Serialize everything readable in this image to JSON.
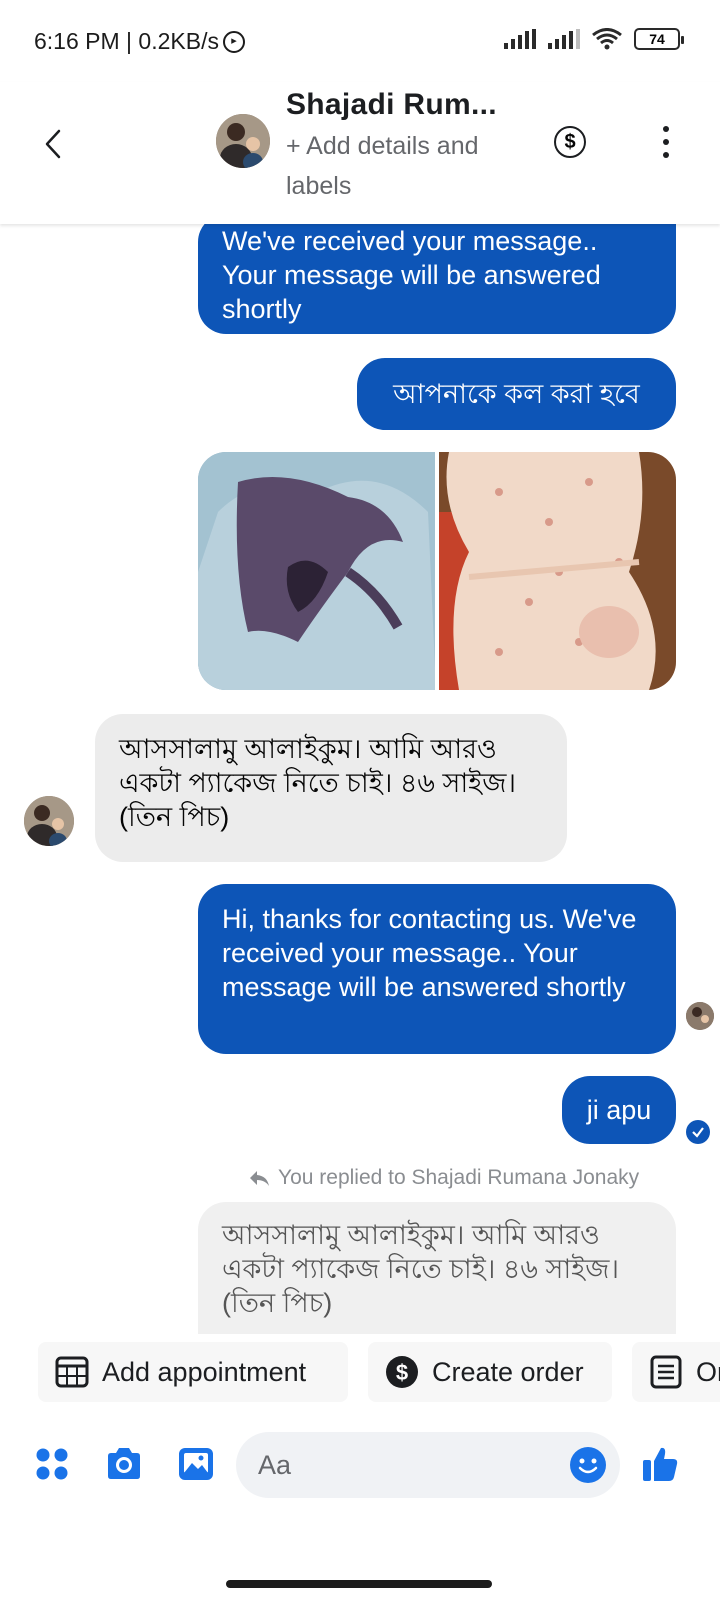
{
  "status_bar": {
    "time_speed": "6:16 PM | 0.2KB/s",
    "battery": "74"
  },
  "header": {
    "contact_name": "Shajadi Rum...",
    "subtitle": "+ Add details and labels"
  },
  "messages": {
    "out1": "We've received your message.. Your message will be answered shortly",
    "out2": "আপনাকে কল করা হবে",
    "in1": "আসসালামু আলাইকুম। আমি আরও একটা প্যাকেজ নিতে চাই। ৪৬ সাইজ। (তিন পিচ)",
    "out3": "Hi, thanks for contacting us. We've received your message.. Your message will be answered shortly",
    "out4": "ji apu",
    "reply_note": "You replied to Shajadi Rumana Jonaky",
    "in2_quoted": "আসসালামু আলাইকুম। আমি আরও একটা প্যাকেজ নিতে চাই। ৪৬ সাইজ। (তিন পিচ)"
  },
  "quick_actions": {
    "add_appointment": "Add appointment",
    "create_order": "Create order",
    "third": "Or"
  },
  "composer": {
    "placeholder": "Aa"
  },
  "colors": {
    "accent": "#0d55b7",
    "icon_blue": "#1a73e8",
    "incoming_bg": "#ececec"
  },
  "icons": {
    "back": "chevron-left-icon",
    "dollar": "dollar-circle-icon",
    "more": "vertical-dots-icon",
    "apps": "grid-dots-icon",
    "camera": "camera-icon",
    "gallery": "image-icon",
    "emoji": "smiley-icon",
    "like": "thumbs-up-icon"
  }
}
